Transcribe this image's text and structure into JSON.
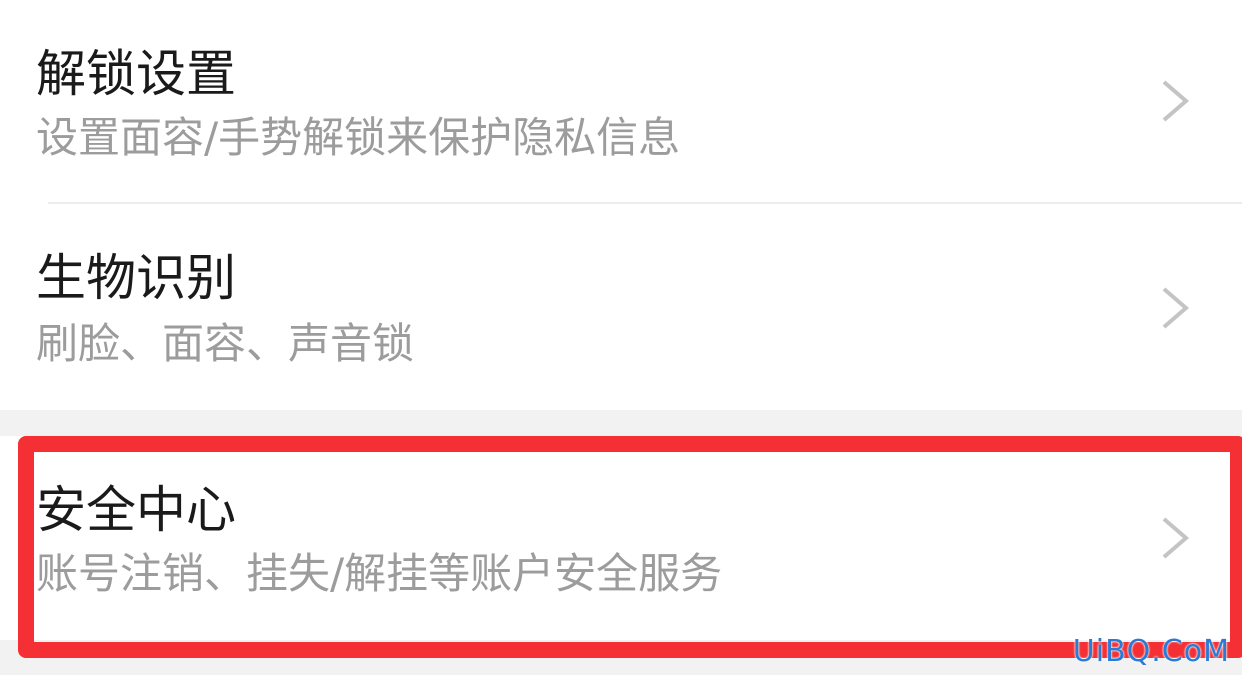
{
  "settings": {
    "items": [
      {
        "title": "解锁设置",
        "subtitle": "设置面容/手势解锁来保护隐私信息"
      },
      {
        "title": "生物识别",
        "subtitle": "刷脸、面容、声音锁"
      },
      {
        "title": "安全中心",
        "subtitle": "账号注销、挂失/解挂等账户安全服务"
      }
    ],
    "chevron_icon": "chevron-right-icon"
  },
  "annotation": {
    "highlight_color": "#f53034"
  },
  "watermark": {
    "text": "UiBQ.CoM"
  }
}
